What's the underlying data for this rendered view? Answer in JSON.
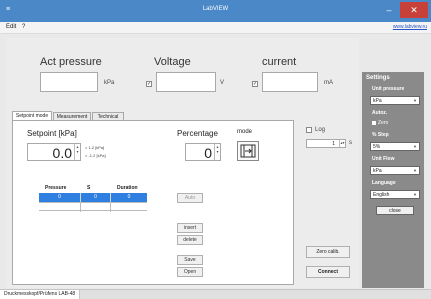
{
  "window": {
    "title": "LabVIEW",
    "app_icon": "app-icon",
    "minimize": "–",
    "close": "✕"
  },
  "menu": {
    "items": [
      "Edit",
      "?"
    ],
    "link": "www.labview.ru"
  },
  "readouts": {
    "pressure": {
      "label": "Act pressure",
      "unit": "kPa"
    },
    "voltage": {
      "label": "Voltage",
      "unit": "V",
      "checked": true
    },
    "current": {
      "label": "current",
      "unit": "mA",
      "checked": true
    }
  },
  "tabs": [
    "Setpoint mode",
    "Measurement",
    "Technical"
  ],
  "setpoint": {
    "title": "Setpoint [kPa]",
    "value": "0.0",
    "range_hi": "< 1.2 [kPa]",
    "range_lo": "> -1.2 [kPa]",
    "percentage_label": "Percentage",
    "percentage_value": "0",
    "mode_label": "mode",
    "mode_icon": "flow-valve-icon"
  },
  "table": {
    "headers": [
      "Pressure",
      "S",
      "Duration"
    ],
    "rows": [
      [
        "0",
        "0",
        "0"
      ],
      [
        "",
        "",
        ""
      ]
    ]
  },
  "buttons": {
    "auto": "Auto",
    "insert": "insert",
    "delete": "delete",
    "save": "Save",
    "open": "Open"
  },
  "log": {
    "label": "Log",
    "interval": "1",
    "unit": "s"
  },
  "zero": "Zero calib.",
  "connect": "Connect",
  "settings": {
    "title": "Settings",
    "unit_pressure_label": "Unit pressure",
    "unit_pressure_value": "kPa",
    "autozero_label": "Autoz.",
    "zero_label": "Zero",
    "step_label": "% Step",
    "step_value": "5%",
    "unit_flow_label": "Unit Flow",
    "unit_flow_value": "kPa",
    "language_label": "Language",
    "language_value": "English",
    "close": "close"
  },
  "status": {
    "text": "Druckmesskopf/Prüfens LAB-48"
  },
  "colors": {
    "titlebar": "#4a88c7",
    "close": "#c7403a",
    "settings_panel": "#8a8a8a",
    "selected_row": "#2f7fe0"
  }
}
